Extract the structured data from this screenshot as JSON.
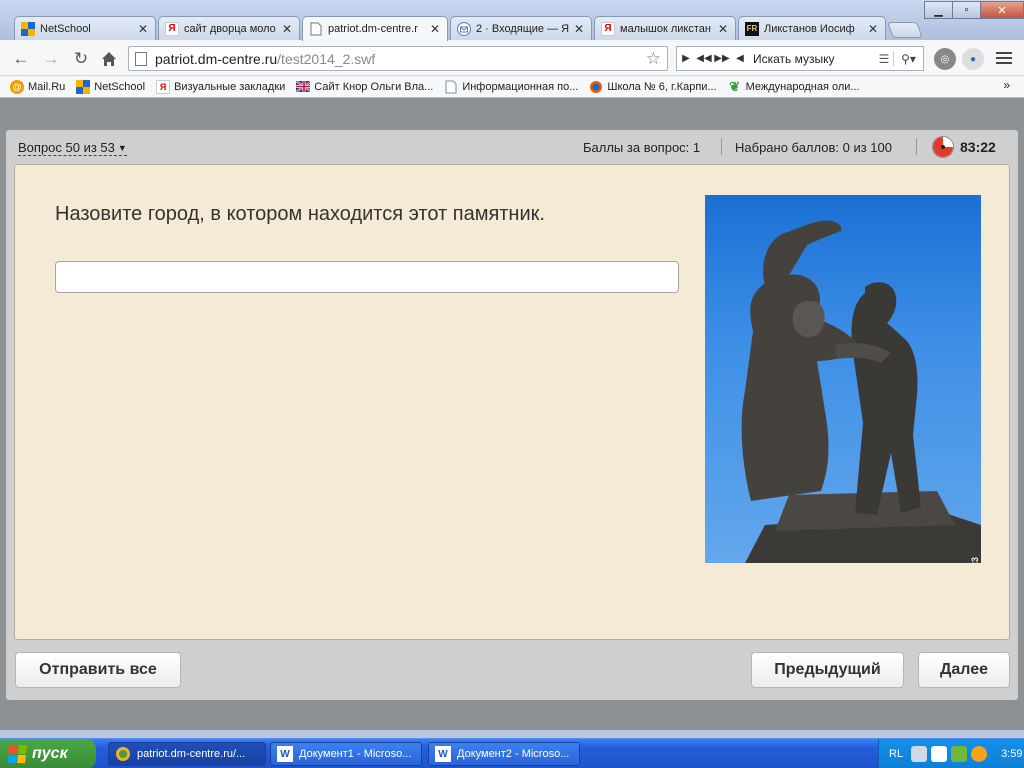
{
  "tabs": [
    {
      "label": "NetSchool",
      "icon": "netschool-icon"
    },
    {
      "label": "сайт дворца моло",
      "icon": "yandex-icon"
    },
    {
      "label": "patriot.dm-centre.r",
      "icon": "page-icon"
    },
    {
      "label": "2 · Входящие — Я",
      "icon": "mail-icon"
    },
    {
      "label": "малышок ликстан",
      "icon": "yandex-icon"
    },
    {
      "label": "Ликстанов Иосиф",
      "icon": "fr-icon"
    }
  ],
  "address": {
    "host": "patriot.dm-centre.ru",
    "path": "/test2014_2.swf"
  },
  "music": {
    "placeholder": "Искать музыку"
  },
  "bookmarks": [
    {
      "label": "Mail.Ru"
    },
    {
      "label": "NetSchool"
    },
    {
      "label": "Визуальные закладки"
    },
    {
      "label": "Сайт Кнор Ольги Вла..."
    },
    {
      "label": "Информационная по..."
    },
    {
      "label": "Школа № 6, г.Карпи..."
    },
    {
      "label": "Международная оли..."
    }
  ],
  "bookmarks_more": "»",
  "quiz": {
    "question_number": "Вопрос 50 из 53",
    "points_per_question": "Баллы за вопрос: 1",
    "points_total": "Набрано баллов: 0 из 100",
    "timer": "83:22",
    "question_text": "Назовите город, в котором находится этот памятник.",
    "answer_value": "",
    "photo_number": "1723",
    "submit_all_label": "Отправить все",
    "previous_label": "Предыдущий",
    "next_label": "Далее"
  },
  "taskbar": {
    "start_label": "пуск",
    "tasks": [
      {
        "label": "patriot.dm-centre.ru/..."
      },
      {
        "label": "Документ1 - Microso..."
      },
      {
        "label": "Документ2 - Microso..."
      }
    ],
    "lang": "RL",
    "clock": "3:59"
  }
}
